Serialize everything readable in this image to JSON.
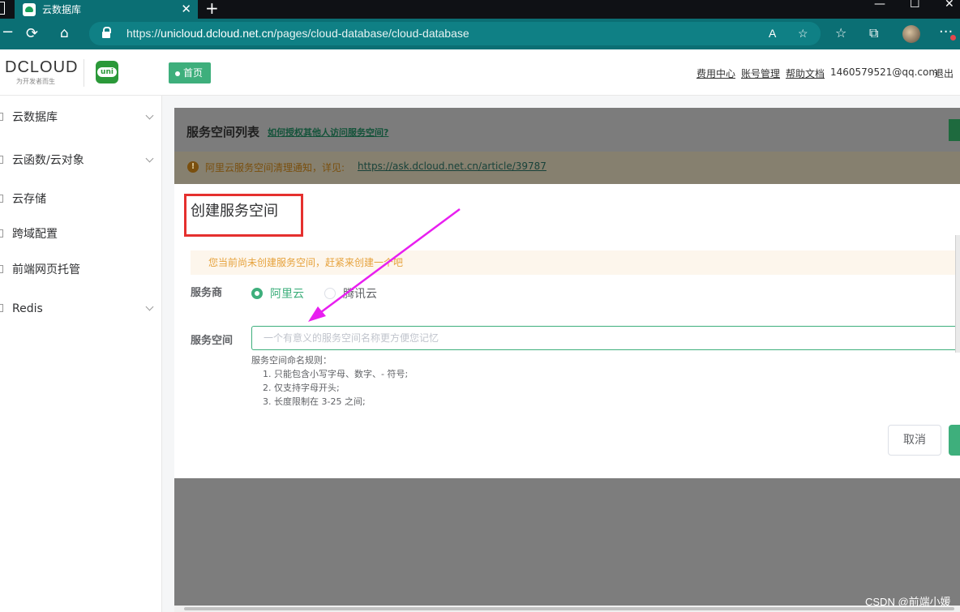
{
  "browser": {
    "tab_title": "云数据库",
    "new_tab_symbol": "+",
    "url_prefix": "https://",
    "url_host": "unicloud.dcloud.net.cn",
    "url_path": "/pages/cloud-database/cloud-database",
    "window_controls": [
      "—",
      "☐",
      "✕"
    ]
  },
  "header": {
    "brand_logo": "DCLOUD",
    "brand_tagline": "为开发者而生",
    "uni_logo": "uni",
    "home_tab": "首页",
    "links": [
      "费用中心",
      "账号管理",
      "帮助文档"
    ],
    "user_email": "1460579521@qq.com",
    "logout": "退出"
  },
  "sidebar": {
    "items": [
      {
        "label": "云数据库",
        "expandable": true
      },
      {
        "label": "云函数/云对象",
        "expandable": true
      },
      {
        "label": "云存储",
        "expandable": false
      },
      {
        "label": "跨域配置",
        "expandable": false
      },
      {
        "label": "前端网页托管",
        "expandable": false
      },
      {
        "label": "Redis",
        "expandable": true
      }
    ]
  },
  "main": {
    "list_title": "服务空间列表",
    "list_help_link": "如何授权其他人访问服务空间?",
    "notice_text": "阿里云服务空间清理通知，详见:",
    "notice_link": "https://ask.dcloud.net.cn/article/39787"
  },
  "dialog": {
    "title": "创建服务空间",
    "info_text": "您当前尚未创建服务空间，赶紧来创建一个吧",
    "provider_label": "服务商",
    "providers": [
      {
        "label": "阿里云",
        "selected": true
      },
      {
        "label": "腾讯云",
        "selected": false
      }
    ],
    "space_label": "服务空间",
    "space_placeholder": "一个有意义的服务空间名称更方便您记忆",
    "rules_title": "服务空间命名规则：",
    "rules": [
      "1. 只能包含小写字母、数字、- 符号;",
      "2. 仅支持字母开头;",
      "3. 长度限制在 3-25 之间;"
    ],
    "cancel_label": "取消"
  },
  "watermark": "CSDN @前端小媛",
  "colors": {
    "browser_teal": "#0b6f74",
    "brand_green": "#3eaf7c",
    "annotation_red": "#e5302e",
    "annotation_magenta": "#e81ff0",
    "overlay_gray": "#7d7d7d",
    "warning_orange": "#e6a23c"
  },
  "icons": [
    "cloud-favicon",
    "close-icon",
    "plus-icon",
    "refresh-icon",
    "home-icon",
    "lock-icon",
    "read-aloud-icon",
    "favorite-add-icon",
    "favorites-icon",
    "collections-icon",
    "more-icon",
    "chevron-down-icon",
    "warning-icon"
  ]
}
